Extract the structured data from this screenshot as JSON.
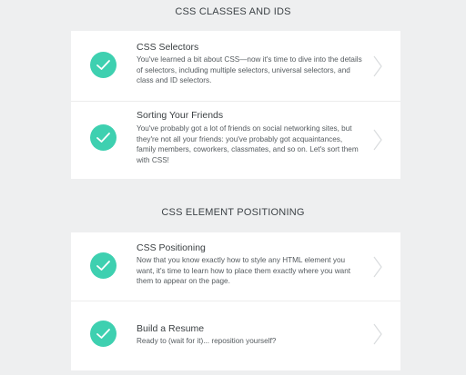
{
  "sections": [
    {
      "title": "CSS CLASSES AND IDS",
      "lessons": [
        {
          "title": "CSS Selectors",
          "description": "You've learned a bit about CSS—now it's time to dive into the details of selectors, including multiple selectors, universal selectors, and class and ID selectors.",
          "completed": true
        },
        {
          "title": "Sorting Your Friends",
          "description": "You've probably got a lot of friends on social networking sites, but they're not all your friends: you've probably got acquaintances, family members, coworkers, classmates, and so on. Let's sort them with CSS!",
          "completed": true
        }
      ]
    },
    {
      "title": "CSS ELEMENT POSITIONING",
      "lessons": [
        {
          "title": "CSS Positioning",
          "description": "Now that you know exactly how to style any HTML element you want, it's time to learn how to place them exactly where you want them to appear on the page.",
          "completed": true
        },
        {
          "title": "Build a Resume",
          "description": "Ready to (wait for it)... reposition yourself?",
          "completed": true
        }
      ]
    }
  ],
  "icons": {
    "completed": "checkmark-icon",
    "navigate": "chevron-right-icon"
  },
  "colors": {
    "background": "#eeeff0",
    "card": "#ffffff",
    "check": "#3ed0b0",
    "chevron": "#d9dcde",
    "title_text": "#3b4043",
    "body_text": "#555b5f"
  }
}
